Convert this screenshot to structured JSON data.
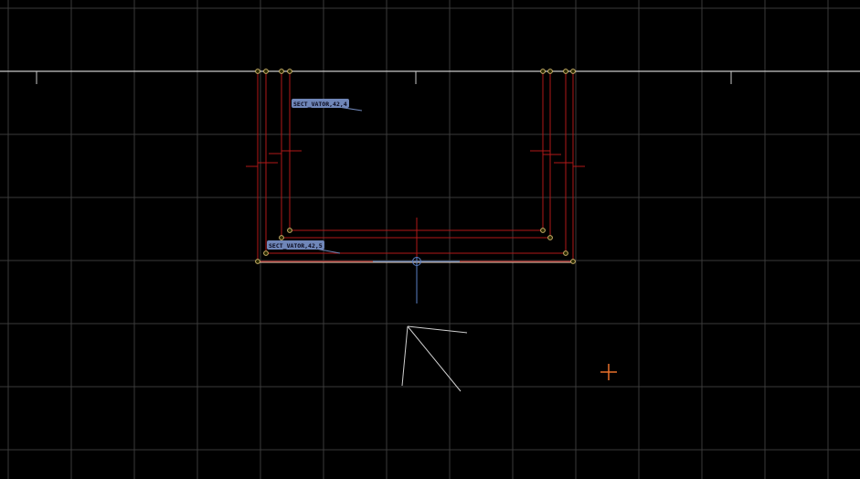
{
  "viewport": {
    "background": "#000000",
    "grid_color": "#3a3a3a",
    "axis_color": "#c8c8c8",
    "geometry_color": "#b01818",
    "vertex_color": "#c9b06a",
    "tag_bg_color": "#6f86b8",
    "tag_text_color": "#0a0a1e",
    "cursor_color": "#e8702a",
    "blue_axis_color": "#5a7fc4"
  },
  "labels": {
    "top_tag": "SECT_VATOR,42,4",
    "bottom_tag": "SECT_VATOR,42,5"
  },
  "icons": {
    "cursor": "crosshair-cursor-icon",
    "pivot": "pivot-circle-icon",
    "camera": "camera-view-icon"
  }
}
